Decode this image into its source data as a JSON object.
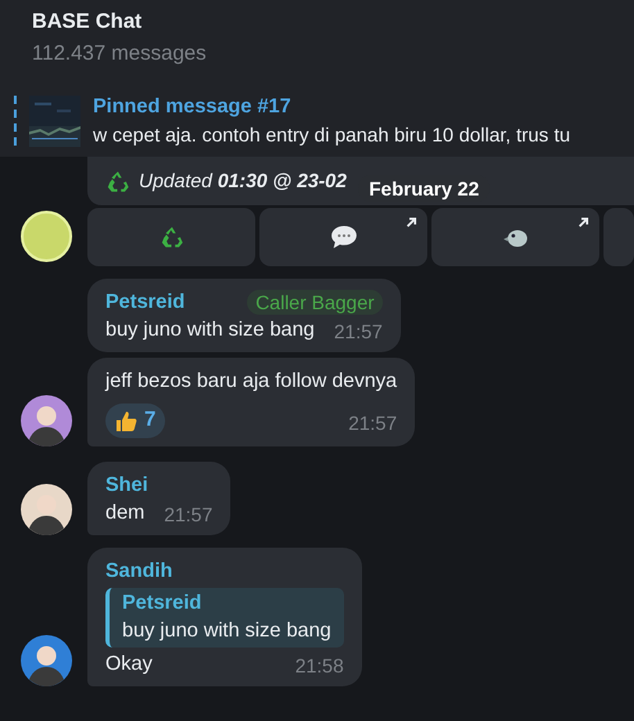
{
  "header": {
    "title": "BASE Chat",
    "subtitle": "112.437 messages"
  },
  "pinned": {
    "label": "Pinned message #17",
    "text": "w cepet aja. contoh entry di panah biru 10 dollar, trus tu"
  },
  "top_message": {
    "text": "Updated **01:30 @ 23-02**"
  },
  "date_pill": "February 22",
  "keyboard": [
    {
      "kind": "full",
      "external": false
    },
    {
      "kind": "full",
      "external": true
    },
    {
      "kind": "full",
      "external": true
    },
    {
      "kind": "cut"
    }
  ],
  "messages": [
    {
      "sender": "Petsreid",
      "badge": "Caller Bagger",
      "text": "buy juno with size bang",
      "time": "21:57",
      "avatar": false
    },
    {
      "text": "jeff bezos baru aja follow devnya",
      "reaction_count": "7",
      "time": "21:57",
      "avatar": true
    },
    {
      "sender": "Shei",
      "text": "dem",
      "time": "21:57",
      "avatar": true
    },
    {
      "sender": "Sandih",
      "reply": {
        "sender": "Petsreid",
        "text": "buy juno with size bang"
      },
      "text": "Okay",
      "time": "21:58",
      "avatar": true
    }
  ]
}
